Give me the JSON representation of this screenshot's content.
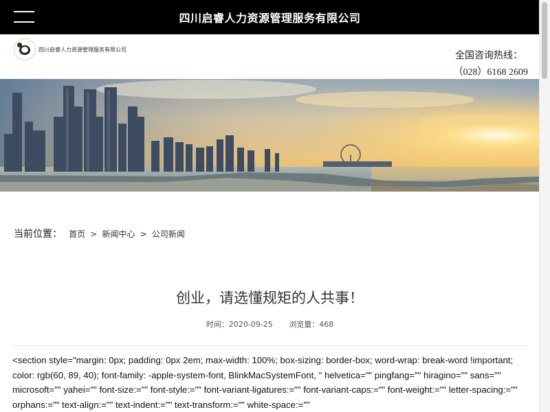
{
  "header": {
    "site_title": "四川启睿人力资源管理服务有限公司",
    "logo_text": "四川启睿人力资源管理服务有限公司",
    "hotline_label": "全国咨询热线：",
    "hotline_number": "（028）6168 2609"
  },
  "breadcrumb": {
    "label": "当前位置：",
    "items": [
      "首页",
      "新闻中心",
      "公司新闻"
    ],
    "separator": ">"
  },
  "article": {
    "title": "创业，请选懂规矩的人共事！",
    "time_label": "时间：",
    "time_value": "2020-09-25",
    "views_label": "浏览量：",
    "views_value": "468",
    "body_text": "<section style=\"margin: 0px; padding: 0px 2em; max-width: 100%; box-sizing: border-box; word-wrap: break-word !important; color: rgb(60, 89, 40); font-family: -apple-system-font, BlinkMacSystemFont, \" helvetica=\"\" pingfang=\"\" hiragino=\"\" sans=\"\" microsoft=\"\" yahei=\"\" font-size:=\"\" font-style:=\"\" font-variant-ligatures:=\"\" font-variant-caps:=\"\" font-weight:=\"\" letter-spacing:=\"\" orphans:=\"\" text-align:=\"\" text-indent:=\"\" text-transform:=\"\" white-space:=\"\""
  },
  "colors": {
    "topbar_bg": "#000000",
    "divider": "#e5e5e5"
  },
  "icons": {
    "menu": "hamburger-icon",
    "logo": "panda-logo-icon"
  }
}
